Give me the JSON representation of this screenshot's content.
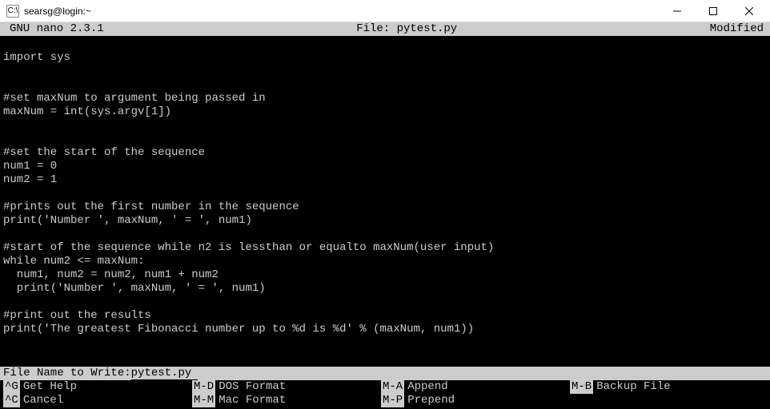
{
  "titlebar": {
    "icon_label": "C:\\",
    "title": "searsg@login:~"
  },
  "nano_header": {
    "version": "GNU nano 2.3.1",
    "file_label": "File: pytest.py",
    "status": "Modified"
  },
  "code_lines": [
    "",
    "import sys",
    "",
    "",
    "#set maxNum to argument being passed in",
    "maxNum = int(sys.argv[1])",
    "",
    "",
    "#set the start of the sequence",
    "num1 = 0",
    "num2 = 1",
    "",
    "#prints out the first number in the sequence",
    "print('Number ', maxNum, ' = ', num1)",
    "",
    "#start of the sequence while n2 is lessthan or equalto maxNum(user input)",
    "while num2 <= maxNum:",
    "  num1, num2 = num2, num1 + num2",
    "  print('Number ', maxNum, ' = ', num1)",
    "",
    "#print out the results",
    "print('The greatest Fibonacci number up to %d is %d' % (maxNum, num1))",
    "",
    "",
    ""
  ],
  "prompt": {
    "label": "File Name to Write: ",
    "value": "pytest.py"
  },
  "shortcuts": {
    "row1": [
      {
        "key": "^G",
        "label": "Get Help"
      },
      {
        "key": "M-D",
        "label": "DOS Format"
      },
      {
        "key": "M-A",
        "label": "Append"
      },
      {
        "key": "M-B",
        "label": "Backup File"
      }
    ],
    "row2": [
      {
        "key": "^C",
        "label": "Cancel"
      },
      {
        "key": "M-M",
        "label": "Mac Format"
      },
      {
        "key": "M-P",
        "label": "Prepend"
      }
    ]
  }
}
